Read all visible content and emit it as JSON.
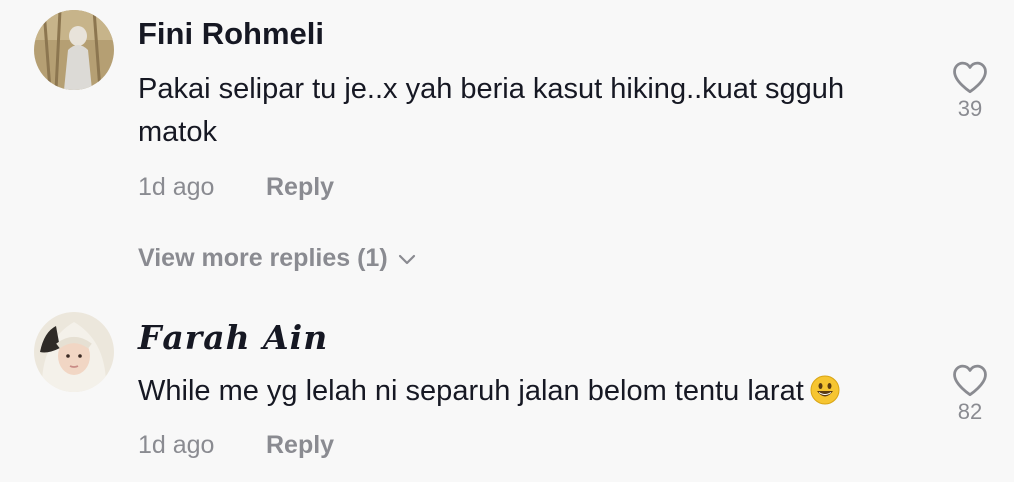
{
  "comments": [
    {
      "username": "Fini Rohmeli",
      "text": "Pakai selipar tu je..x yah beria kasut hiking..kuat sgguh matok",
      "time": "1d ago",
      "reply_label": "Reply",
      "likes": "39",
      "view_more": "View more replies (1)"
    },
    {
      "username": "𝑭𝒂𝒓𝒂𝒉 𝑨𝒊𝒏",
      "text": "While me yg lelah ni separuh jalan belom tentu larat",
      "time": "1d ago",
      "reply_label": "Reply",
      "likes": "82"
    }
  ],
  "icons": {
    "like": "heart-outline-icon",
    "expand": "chevron-down-icon",
    "emoji": "smiling-face-emoji"
  },
  "colors": {
    "background": "#f8f8f8",
    "primary_text": "#161823",
    "secondary_text": "#8a8b91"
  }
}
